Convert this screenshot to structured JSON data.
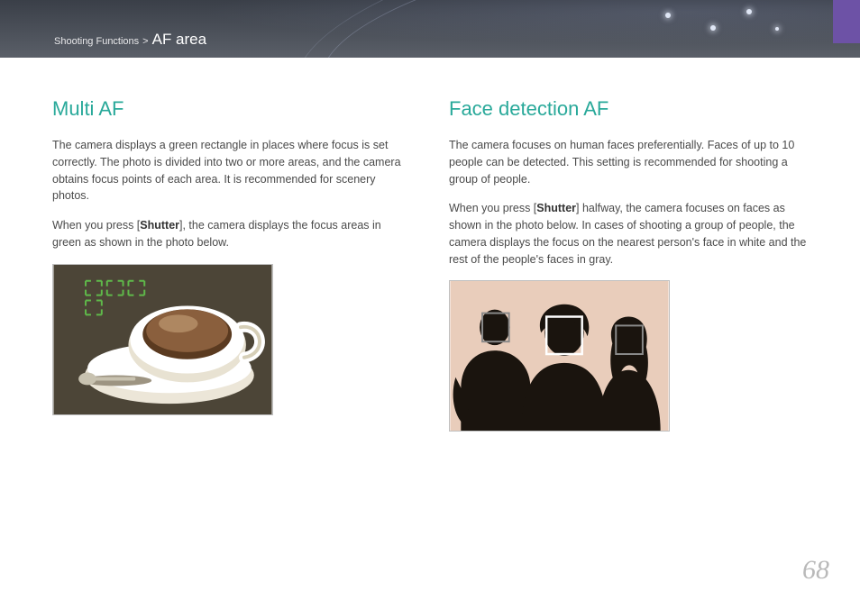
{
  "header": {
    "breadcrumb_parent": "Shooting Functions",
    "breadcrumb_sep": ">",
    "section": "AF area"
  },
  "left": {
    "title": "Multi AF",
    "p1": "The camera displays a green rectangle in places where focus is set correctly. The photo is divided into two or more areas, and the camera obtains focus points of each area. It is recommended for scenery photos.",
    "p2_a": "When you press [",
    "p2_b": "Shutter",
    "p2_c": "], the camera displays the focus areas in green as shown in the photo below."
  },
  "right": {
    "title": "Face detection AF",
    "p1": "The camera focuses on human faces preferentially. Faces of up to 10 people can be detected. This setting is recommended for shooting a group of people.",
    "p2_a": "When you press [",
    "p2_b": "Shutter",
    "p2_c": "] halfway, the camera focuses on faces as shown in the photo below. In cases of shooting a group of people, the camera displays the focus on the nearest person's face in white and the rest of the people's faces in gray."
  },
  "page_number": "68"
}
